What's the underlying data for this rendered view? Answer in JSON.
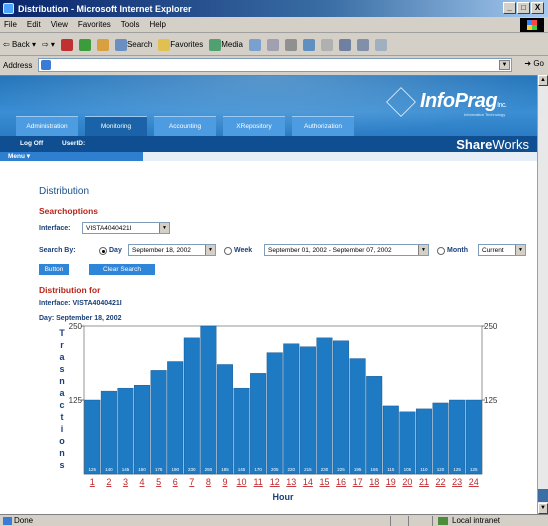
{
  "window": {
    "title": "Distribution - Microsoft Internet Explorer",
    "buttons": [
      "_",
      "□",
      "X"
    ]
  },
  "menubar": [
    "File",
    "Edit",
    "View",
    "Favorites",
    "Tools",
    "Help"
  ],
  "toolbar": {
    "back": "Back",
    "search": "Search",
    "favorites": "Favorites",
    "media": "Media"
  },
  "addressbar": {
    "label": "Address",
    "value": "",
    "go": "Go"
  },
  "header": {
    "logo_text": "InfoPrag",
    "logo_suffix": "Inc.",
    "logo_sub": "Information Technology",
    "tabs": [
      "Administration",
      "Monitoring",
      "Accounting",
      "XRepository",
      "Authorization"
    ],
    "active_tab": "Monitoring",
    "nav_links": [
      "Log Off",
      "UserID:"
    ],
    "brand_bold": "Share",
    "brand_light": "Works",
    "menu_label": "Menu ▾"
  },
  "page": {
    "title": "Distribution",
    "search_options_title": "Searchoptions",
    "interface_label": "Interface:",
    "interface_value": "VISTA4040421I",
    "search_by_label": "Search By:",
    "day_label": "Day",
    "day_value": "September 18, 2002",
    "week_label": "Week",
    "week_value": "September 01, 2002 - September 07, 2002",
    "month_label": "Month",
    "month_value": "Current",
    "selected_mode": "Day",
    "button_label": "Button",
    "clear_label": "Clear Search",
    "distribution_for_title": "Distribution for",
    "interface_info": "Interface: VISTA4040421I",
    "day_info": "Day: September 18, 2002"
  },
  "status": {
    "text": "Done",
    "zone": "Local intranet"
  },
  "colors": {
    "bar": "#1f7ac4",
    "label": "#1a3f78",
    "accent": "#b8241a",
    "hour_link": "#c0262a"
  },
  "chart_data": {
    "type": "bar",
    "title": "",
    "xlabel": "Hour",
    "ylabel": "Trasnactions",
    "ylim": [
      0,
      250
    ],
    "yticks": [
      125,
      250
    ],
    "categories": [
      "1",
      "2",
      "3",
      "4",
      "5",
      "6",
      "7",
      "8",
      "9",
      "10",
      "11",
      "12",
      "13",
      "14",
      "15",
      "16",
      "17",
      "18",
      "19",
      "20",
      "21",
      "22",
      "23",
      "24"
    ],
    "values": [
      125,
      140,
      145,
      150,
      175,
      190,
      230,
      250,
      185,
      145,
      170,
      205,
      220,
      215,
      230,
      225,
      195,
      165,
      115,
      105,
      110,
      120,
      125,
      125
    ]
  }
}
